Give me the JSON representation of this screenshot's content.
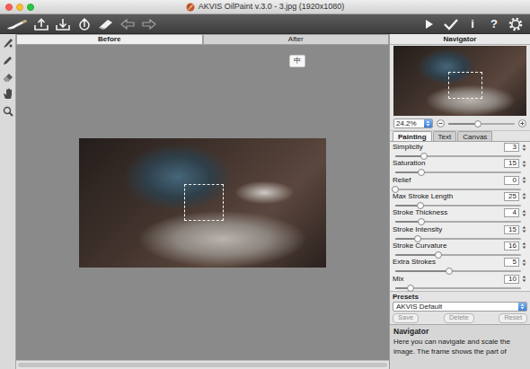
{
  "window": {
    "title": "AKVIS OilPaint v.3.0 - 3.jpg (1920x1080)"
  },
  "toolbar": {
    "undo": {
      "disabled": true
    },
    "redo": {
      "disabled": true
    },
    "info": "i",
    "help": "?"
  },
  "view_tabs": [
    {
      "label": "Before",
      "selected": true
    },
    {
      "label": "After",
      "selected": false
    }
  ],
  "canvas": {
    "badge": "中"
  },
  "navigator": {
    "title": "Navigator",
    "zoom": "24.2%",
    "zoom_level": 0.45
  },
  "panel_tabs": [
    {
      "label": "Painting",
      "selected": true
    },
    {
      "label": "Text",
      "selected": false
    },
    {
      "label": "Canvas",
      "selected": false
    }
  ],
  "parameters": [
    {
      "name": "Simplicity",
      "value": "3",
      "level": 0.23
    },
    {
      "name": "Saturation",
      "value": "15",
      "level": 0.21
    },
    {
      "name": "Relief",
      "value": "0",
      "level": 0
    },
    {
      "name": "Max Stroke Length",
      "value": "25",
      "level": 0.2
    },
    {
      "name": "Stroke Thickness",
      "value": "4",
      "level": 0.21
    },
    {
      "name": "Stroke Intensity",
      "value": "15",
      "level": 0.18
    },
    {
      "name": "Stroke Curvature",
      "value": "16",
      "level": 0.34
    },
    {
      "name": "Extra Strokes",
      "value": "5",
      "level": 0.43
    },
    {
      "name": "Mix",
      "value": "10",
      "level": 0.12
    }
  ],
  "presets": {
    "title": "Presets",
    "value": "AKVIS Default",
    "buttons": [
      {
        "label": "Save",
        "disabled": true
      },
      {
        "label": "Delete",
        "disabled": true
      },
      {
        "label": "Reset",
        "disabled": true
      }
    ]
  },
  "help": {
    "title": "Navigator",
    "text": "Here you can navigate and scale the image. The frame shows the part of"
  }
}
